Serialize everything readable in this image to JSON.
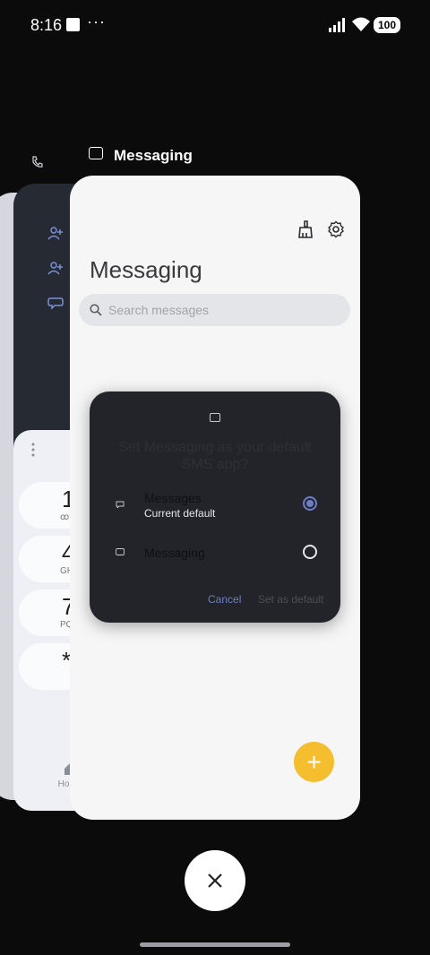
{
  "status_bar": {
    "time": "8:16",
    "dots": "···",
    "battery": "100"
  },
  "main_card": {
    "label": "Messaging",
    "page_title": "Messaging",
    "search_placeholder": "Search messages",
    "fab_symbol": "+"
  },
  "dialog": {
    "title": "Set Messaging as your default SMS app?",
    "options": [
      {
        "name": "Messages",
        "subtitle": "Current default",
        "selected": true
      },
      {
        "name": "Messaging",
        "subtitle": "",
        "selected": false
      }
    ],
    "cancel_label": "Cancel",
    "set_default_label": "Set as default"
  },
  "dialer": {
    "keys": [
      {
        "num": "1",
        "sub": "ꝏ"
      },
      {
        "num": "4",
        "sub": "GHI"
      },
      {
        "num": "7",
        "sub": "PQRS"
      },
      {
        "num": "*",
        "sub": ""
      }
    ],
    "home_label": "Home"
  },
  "colors": {
    "accent": "#6d7ec6",
    "fab": "#f5be2f",
    "dialog_bg": "#23242a"
  }
}
